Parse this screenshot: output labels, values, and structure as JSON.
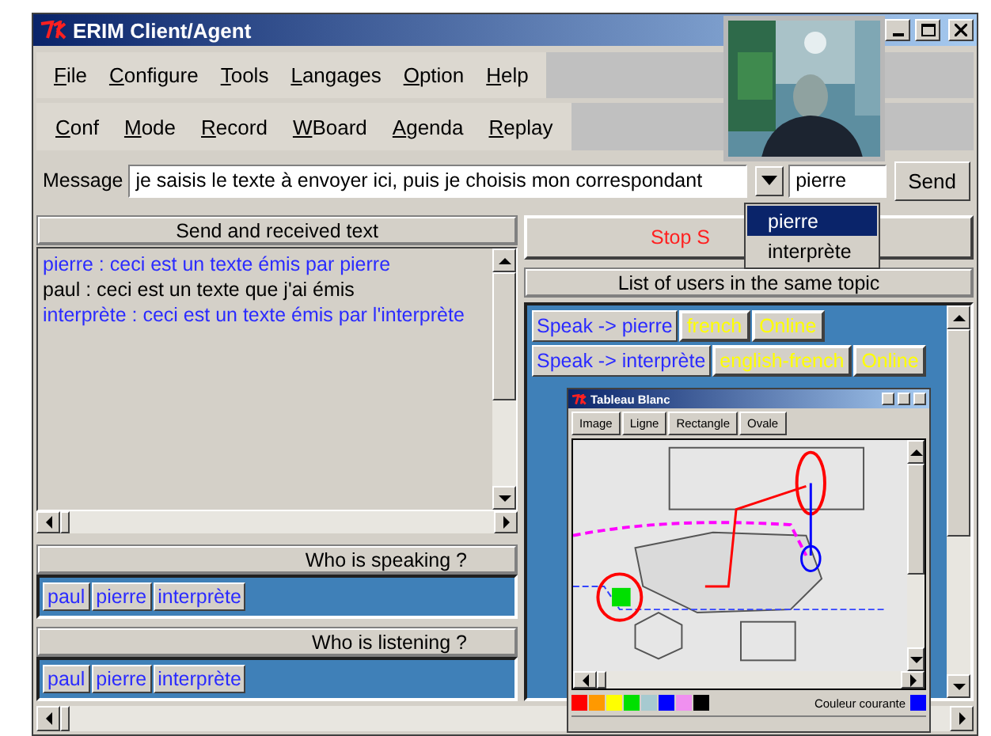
{
  "window": {
    "title": "ERIM Client/Agent"
  },
  "menu": [
    "File",
    "Configure",
    "Tools",
    "Langages",
    "Option",
    "Help"
  ],
  "toolbar": [
    "Conf",
    "Mode",
    "Record",
    "WBoard",
    "Agenda",
    "Replay"
  ],
  "message": {
    "label": "Message",
    "value": "je saisis le texte à envoyer ici, puis je choisis mon correspondant"
  },
  "recipient": {
    "value": "pierre"
  },
  "send_button": "Send",
  "recipient_dropdown": {
    "options": [
      {
        "label": "pierre",
        "selected": true
      },
      {
        "label": "interprète",
        "selected": false
      }
    ]
  },
  "chat": {
    "header": "Send and received text",
    "lines": [
      {
        "text": "pierre : ceci est un texte émis par pierre",
        "color": "#2a2aff"
      },
      {
        "text": "paul : ceci est un texte que j'ai émis",
        "color": "#000000"
      },
      {
        "text": "interprète : ceci est un texte émis par l'interprète",
        "color": "#2a2aff"
      }
    ]
  },
  "stop_button": "Stop S",
  "users": {
    "header": "List of users in the same topic",
    "rows": [
      {
        "speak": "Speak -> pierre",
        "language": "french",
        "status": "Online"
      },
      {
        "speak": "Speak -> interprète",
        "language": "english-french",
        "status": "Online"
      }
    ]
  },
  "speaking": {
    "header": "Who is speaking ?",
    "names": [
      "paul",
      "pierre",
      "interprète"
    ]
  },
  "listening": {
    "header": "Who is listening ?",
    "names": [
      "paul",
      "pierre",
      "interprète"
    ]
  },
  "whiteboard": {
    "title": "Tableau Blanc",
    "tools": [
      "Image",
      "Ligne",
      "Rectangle",
      "Ovale"
    ],
    "palette": [
      {
        "color": "#ff0000"
      },
      {
        "color": "#ff9900"
      },
      {
        "color": "#ffff00"
      },
      {
        "color": "#00e000"
      },
      {
        "color": "#a6cad0"
      },
      {
        "color": "#0000ff"
      },
      {
        "color": "#f090f0"
      },
      {
        "color": "#000000"
      }
    ],
    "current_label": "Couleur courante",
    "current_swatch": {
      "color": "#0000ff"
    }
  }
}
